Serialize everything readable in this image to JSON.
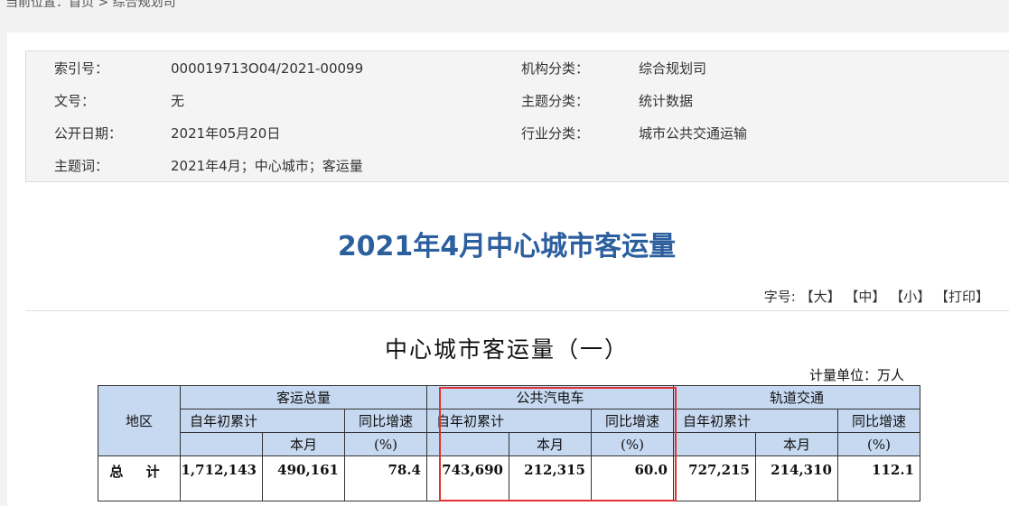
{
  "breadcrumb": {
    "prefix": "当前位置：",
    "home": "首页",
    "sep": " > ",
    "current": "综合规划司"
  },
  "meta": {
    "index_key": "索引号：",
    "index_val": "000019713O04/2021-00099",
    "org_key": "机构分类：",
    "org_val": "综合规划司",
    "docno_key": "文号：",
    "docno_val": "无",
    "topic_key": "主题分类：",
    "topic_val": "统计数据",
    "date_key": "公开日期：",
    "date_val": "2021年05月20日",
    "industry_key": "行业分类：",
    "industry_val": "城市公共交通运输",
    "keywords_key": "主题词：",
    "keywords_val": "2021年4月；中心城市；客运量"
  },
  "doc_title": "2021年4月中心城市客运量",
  "fontsize": {
    "label": "字号:",
    "large": "【大】",
    "medium": "【中】",
    "small": "【小】",
    "print": "【打印】"
  },
  "table_title": "中心城市客运量（一）",
  "unit": "计量单位：万人",
  "table": {
    "region_header": "地区",
    "groups": [
      "客运总量",
      "公共汽电车",
      "轨道交通"
    ],
    "ytd_header": "自年初累计",
    "month_header": "本月",
    "yoy_header": "同比增速",
    "yoy_unit": "(%)",
    "rows": [
      {
        "region": "总 计",
        "values": [
          "1,712,143",
          "490,161",
          "78.4",
          "743,690",
          "212,315",
          "60.0",
          "727,215",
          "214,310",
          "112.1"
        ]
      }
    ]
  },
  "colors": {
    "title": "#2c5f9e",
    "header_bg": "#c6d9f1",
    "highlight": "#e0322f"
  }
}
